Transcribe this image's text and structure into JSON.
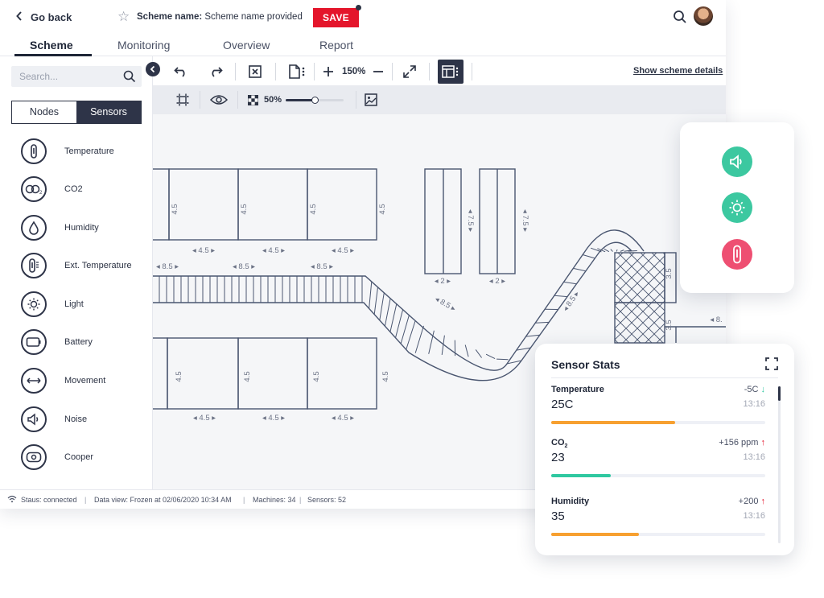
{
  "header": {
    "back_label": "Go back",
    "scheme_name_label": "Scheme name:",
    "scheme_name_value": "Scheme name provided",
    "save_label": "SAVE"
  },
  "tabs": [
    {
      "label": "Scheme",
      "active": true
    },
    {
      "label": "Monitoring",
      "active": false
    },
    {
      "label": "Overview",
      "active": false
    },
    {
      "label": "Report",
      "active": false
    }
  ],
  "sidebar": {
    "search_placeholder": "Search...",
    "toggle": {
      "nodes": "Nodes",
      "sensors": "Sensors",
      "selected": "Sensors"
    },
    "items": [
      {
        "label": "Temperature",
        "icon": "thermometer-icon"
      },
      {
        "label": "CO2",
        "icon": "co2-icon"
      },
      {
        "label": "Humidity",
        "icon": "droplet-icon"
      },
      {
        "label": "Ext. Temperature",
        "icon": "ext-thermometer-icon"
      },
      {
        "label": "Light",
        "icon": "sun-icon"
      },
      {
        "label": "Battery",
        "icon": "battery-icon"
      },
      {
        "label": "Movement",
        "icon": "movement-icon"
      },
      {
        "label": "Noise",
        "icon": "speaker-icon"
      },
      {
        "label": "Cooper",
        "icon": "cooper-icon"
      }
    ]
  },
  "toolbar": {
    "zoom": "150%",
    "show_details": "Show scheme details",
    "opacity": "50%",
    "opacity_value": 0.5
  },
  "canvas": {
    "dim_4_5": "4.5",
    "dim_8_5": "8.5",
    "dim_7_5": "7.5",
    "dim_2": "2",
    "dim_3_5": "3.5",
    "dim_8": "8."
  },
  "status": {
    "connection": "Staus: connected",
    "data_view": "Data view: Frozen at 02/06/2020 10:34 AM",
    "machines": "Machines: 34",
    "sensors": "Sensors: 52"
  },
  "icon_panel": {
    "buttons": [
      {
        "icon": "speaker-icon",
        "color": "#3cc8a0"
      },
      {
        "icon": "sun-icon",
        "color": "#3cc8a0"
      },
      {
        "icon": "thermometer-icon",
        "color": "#ee4f72"
      }
    ]
  },
  "sensor_stats": {
    "title": "Sensor Stats",
    "rows": [
      {
        "name": "Temperature",
        "value": "25C",
        "delta": "-5C",
        "trend": "down",
        "time": "13:16",
        "level": 0.58,
        "color": "#f7a030"
      },
      {
        "name": "CO",
        "name_sub": "2",
        "value": "23",
        "delta": "+156 ppm",
        "trend": "up",
        "time": "13:16",
        "level": 0.28,
        "color": "#2fc8a0"
      },
      {
        "name": "Humidity",
        "value": "35",
        "delta": "+200",
        "trend": "up",
        "time": "13:16",
        "level": 0.41,
        "color": "#f7a030"
      }
    ],
    "trend_colors": {
      "down": "#2fc8a0",
      "up": "#e4152b"
    }
  }
}
